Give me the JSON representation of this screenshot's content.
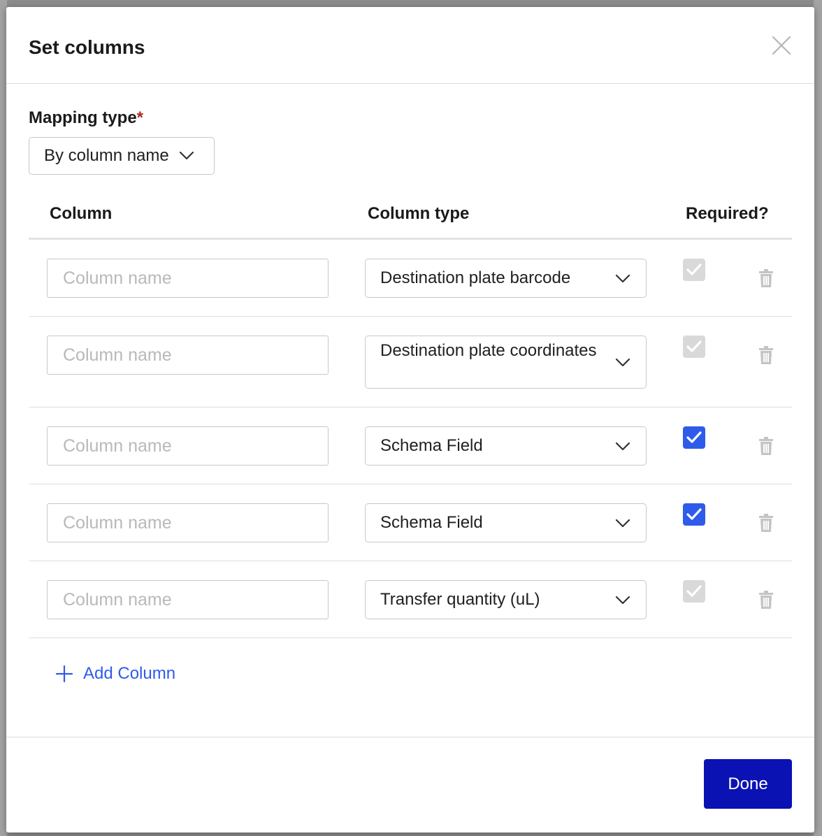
{
  "modal": {
    "title": "Set columns",
    "mapping_type_label": "Mapping type",
    "required_marker": "*",
    "mapping_type_value": "By column name"
  },
  "table": {
    "headers": {
      "column": "Column",
      "column_type": "Column type",
      "required": "Required?"
    },
    "rows": [
      {
        "name_placeholder": "Column name",
        "type": "Destination plate barcode",
        "required": "checked (disabled)"
      },
      {
        "name_placeholder": "Column name",
        "type": "Destination plate coordinates",
        "required": "checked (disabled)"
      },
      {
        "name_placeholder": "Column name",
        "type": "Schema Field",
        "required": "checked"
      },
      {
        "name_placeholder": "Column name",
        "type": "Schema Field",
        "required": "checked"
      },
      {
        "name_placeholder": "Column name",
        "type": "Transfer quantity (uL)",
        "required": "checked (disabled)"
      }
    ]
  },
  "add_column_label": "Add Column",
  "done_label": "Done",
  "icons": {
    "close": "close-icon",
    "chevron": "chevron-down-icon",
    "check": "check-icon",
    "trash": "trash-icon",
    "plus": "plus-icon"
  },
  "colors": {
    "accent": "#2f5bea",
    "primary_button": "#0a12b4",
    "required_star": "#b3261e",
    "disabled_check": "#d9d9d9"
  }
}
